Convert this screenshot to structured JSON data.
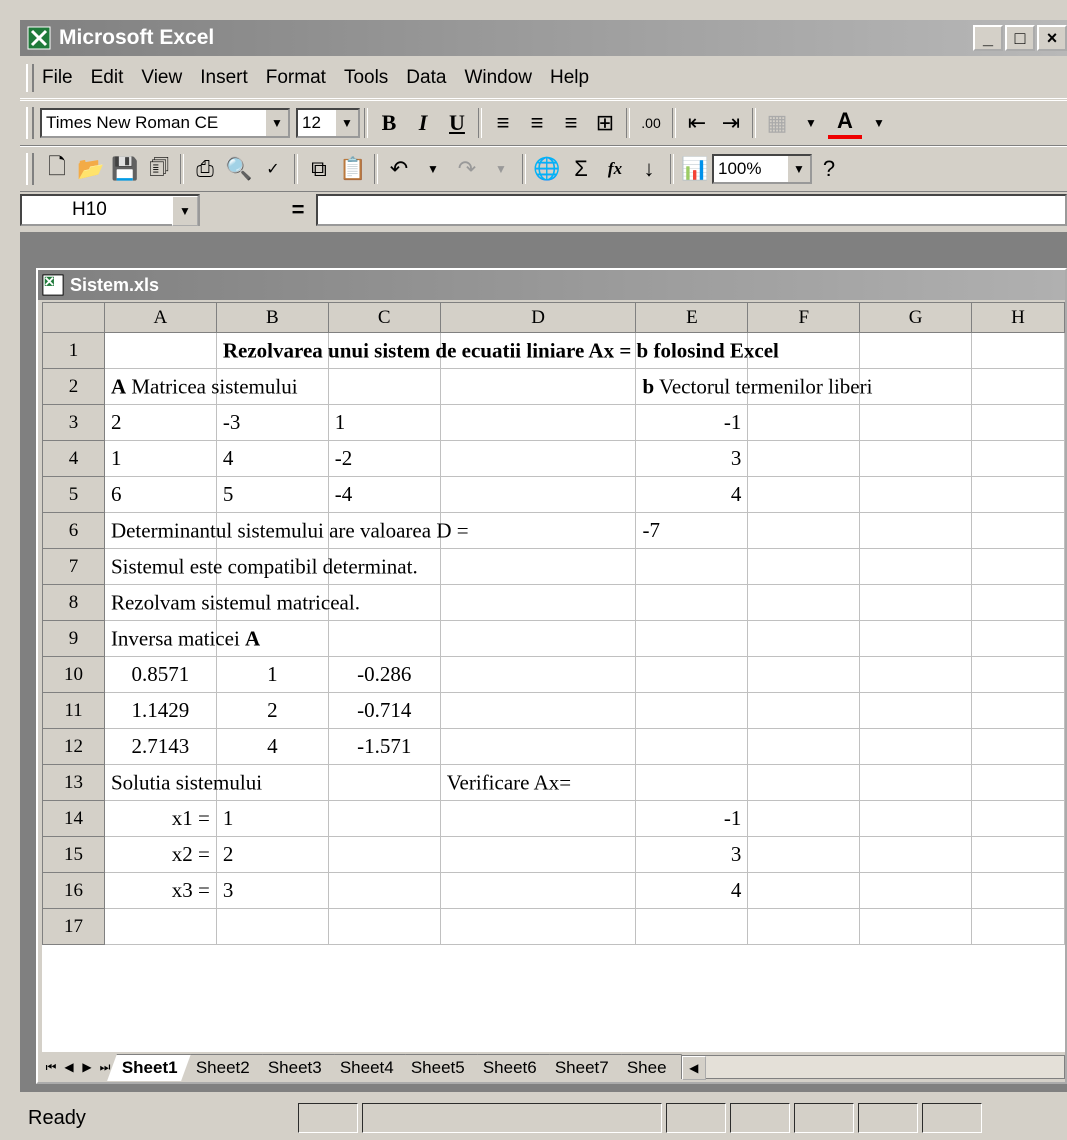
{
  "app": {
    "title": "Microsoft Excel"
  },
  "window_buttons": {
    "minimize": "_",
    "maximize": "□",
    "close": "×"
  },
  "menu": [
    "File",
    "Edit",
    "View",
    "Insert",
    "Format",
    "Tools",
    "Data",
    "Window",
    "Help"
  ],
  "format_toolbar": {
    "font": "Times New Roman CE",
    "size": "12",
    "bold": "B",
    "italic": "I",
    "underline": "U"
  },
  "standard_toolbar": {
    "zoom": "100%",
    "sigma": "Σ",
    "fx": "fx"
  },
  "formula_bar": {
    "cell_ref": "H10",
    "equals": "=",
    "content": ""
  },
  "workbook": {
    "title": "Sistem.xls"
  },
  "columns": [
    "A",
    "B",
    "C",
    "D",
    "E",
    "F",
    "G",
    "H"
  ],
  "cells": {
    "r1": {
      "title": "Rezolvarea unui sistem de ecuatii liniare Ax = b folosind Excel"
    },
    "r2": {
      "a_bold": "A",
      "a_text": "Matricea sistemului",
      "e_bold": "b",
      "e_text": "Vectorul termenilor liberi"
    },
    "r3": {
      "a": "2",
      "b": "-3",
      "c": "1",
      "e": "-1"
    },
    "r4": {
      "a": "1",
      "b": "4",
      "c": "-2",
      "e": "3"
    },
    "r5": {
      "a": "6",
      "b": "5",
      "c": "-4",
      "e": "4"
    },
    "r6": {
      "a": "Determinantul sistemului are valoarea D =",
      "e": "-7"
    },
    "r7": {
      "a": "Sistemul este compatibil determinat."
    },
    "r8": {
      "a": "Rezolvam sistemul matriceal."
    },
    "r9": {
      "a": "Inversa maticei ",
      "a_bold": "A"
    },
    "r10": {
      "a": "0.8571",
      "b": "1",
      "c": "-0.286"
    },
    "r11": {
      "a": "1.1429",
      "b": "2",
      "c": "-0.714"
    },
    "r12": {
      "a": "2.7143",
      "b": "4",
      "c": "-1.571"
    },
    "r13": {
      "a": "Solutia sistemului",
      "d": "Verificare Ax="
    },
    "r14": {
      "a": "x1 =",
      "b": "1",
      "e": "-1"
    },
    "r15": {
      "a": "x2 =",
      "b": "2",
      "e": "3"
    },
    "r16": {
      "a": "x3 =",
      "b": "3",
      "e": "4"
    }
  },
  "sheet_tabs": [
    "Sheet1",
    "Sheet2",
    "Sheet3",
    "Sheet4",
    "Sheet5",
    "Sheet6",
    "Sheet7",
    "Shee"
  ],
  "status": {
    "text": "Ready"
  }
}
